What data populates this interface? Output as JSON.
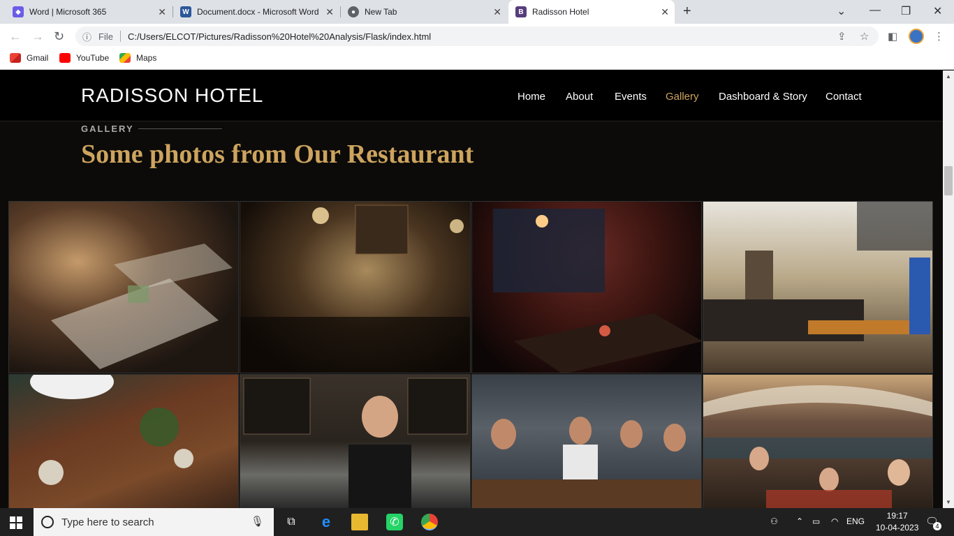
{
  "browser": {
    "tabs": [
      {
        "title": "Word | Microsoft 365",
        "icon": "microsoft365-icon",
        "active": false
      },
      {
        "title": "Document.docx - Microsoft Word",
        "icon": "word-icon",
        "active": false
      },
      {
        "title": "New Tab",
        "icon": "chrome-icon",
        "active": false
      },
      {
        "title": "Radisson Hotel",
        "icon": "bootstrap-icon",
        "active": true
      }
    ],
    "address": {
      "scheme_label": "File",
      "url": "C:/Users/ELCOT/Pictures/Radisson%20Hotel%20Analysis/Flask/index.html"
    },
    "bookmarks": [
      {
        "label": "Gmail",
        "icon": "gmail-icon"
      },
      {
        "label": "YouTube",
        "icon": "youtube-icon"
      },
      {
        "label": "Maps",
        "icon": "maps-icon"
      }
    ]
  },
  "site": {
    "brand": "RADISSON HOTEL",
    "nav": [
      {
        "label": "Home",
        "active": false
      },
      {
        "label": "About",
        "active": false
      },
      {
        "label": "Events",
        "active": false
      },
      {
        "label": "Gallery",
        "active": true
      },
      {
        "label": "Dashboard & Story",
        "active": false
      },
      {
        "label": "Contact",
        "active": false
      }
    ],
    "accent_color": "#cda45e"
  },
  "gallery": {
    "label": "GALLERY",
    "title": "Some photos from Our Restaurant",
    "photos": [
      {
        "subject": "restaurant-tables-photo"
      },
      {
        "subject": "bar-interior-photo"
      },
      {
        "subject": "wine-glasses-table-photo"
      },
      {
        "subject": "cafe-counter-photo"
      },
      {
        "subject": "dining-table-overhead-photo"
      },
      {
        "subject": "beer-taps-server-photo"
      },
      {
        "subject": "friends-patio-photo"
      },
      {
        "subject": "outdoor-celebration-photo"
      }
    ]
  },
  "taskbar": {
    "search_placeholder": "Type here to search",
    "language": "ENG",
    "time": "19:17",
    "date": "10-04-2023",
    "notification_count": "4"
  }
}
